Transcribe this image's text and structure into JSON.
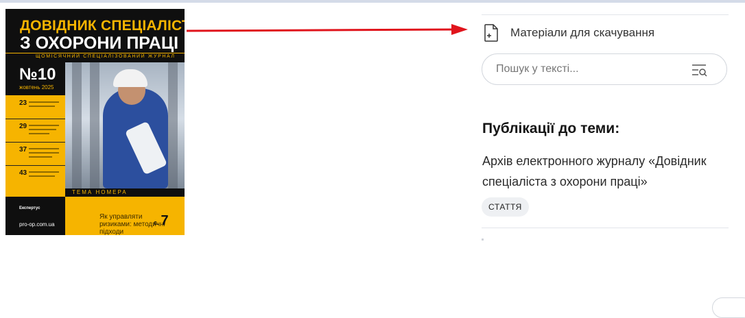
{
  "cover": {
    "title_line1": "ДОВІДНИК СПЕЦІАЛІСТА",
    "title_line2": "З ОХОРОНИ ПРАЦІ",
    "subtitle": "ЩОМІСЯЧНИЙ СПЕЦІАЛІЗОВАНИЙ ЖУРНАЛ",
    "issue_number": "№10",
    "issue_date": "жовтень 2025",
    "toc_pages": [
      "23",
      "29",
      "37",
      "43"
    ],
    "publisher": "Експертус",
    "website": "pro-op.com.ua",
    "theme_label": "ТЕМА НОМЕРА",
    "tagline": "Як управляти ризиками: методичні підходи",
    "page_prefix": "с.",
    "page_number": "7",
    "colors": {
      "accent": "#f6b400",
      "dark": "#0f0f0f"
    }
  },
  "annotation": {
    "arrow_color": "#e0141c"
  },
  "sidebar": {
    "materials_label": "Матеріали для скачування",
    "materials_icon": "file-add-icon",
    "search_placeholder": "Пошук у тексті...",
    "search_icon": "search-list-icon",
    "publications_title": "Публікації до теми:",
    "publications": [
      {
        "title": "Архів електронного журналу «Довідник спеціаліста з охорони праці»",
        "tag": "СТАТТЯ"
      }
    ]
  }
}
